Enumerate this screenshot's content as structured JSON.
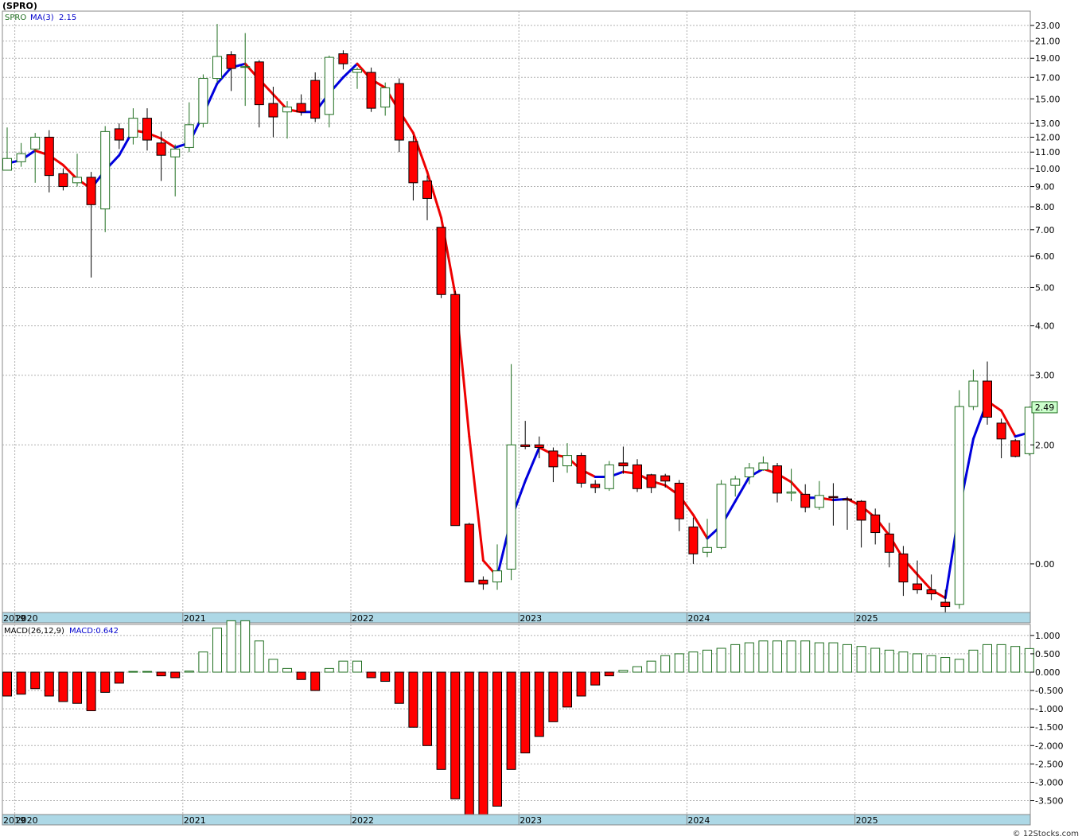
{
  "title": "(SPRO)",
  "legend": {
    "symbol": "SPRO",
    "ma_label": "MA(3)",
    "ma_value": "2.15"
  },
  "macd_label": {
    "name": "MACD(26,12,9)",
    "value_text": "MACD:0.642"
  },
  "last_price": "2.49",
  "watermark": "© 12Stocks.com",
  "colors": {
    "up": "#1f6e1f",
    "down": "#ff0000",
    "ma_up": "#0000dd",
    "ma_down": "#ee0000",
    "axis_band": "#add8e6"
  },
  "chart_data": [
    {
      "type": "candlestick",
      "name": "SPRO",
      "yscale": "log",
      "ylim": [
        0.75,
        25
      ],
      "x_labels": [
        "2019",
        "2020",
        "2021",
        "2022",
        "2023",
        "2024",
        "2025"
      ],
      "y_ticks": [
        23,
        21,
        19,
        17,
        15,
        13,
        12,
        11,
        10,
        9,
        8,
        7,
        6,
        5,
        4,
        3,
        2,
        1
      ],
      "y_tick_labels": [
        "23.00",
        "21.00",
        "19.00",
        "17.00",
        "15.00",
        "13.00",
        "12.00",
        "11.00",
        "10.00",
        "9.00",
        "8.00",
        "7.00",
        "6.00",
        "5.00",
        "4.00",
        "3.00",
        "2.00",
        "0.00"
      ],
      "candles": [
        {
          "date": "2019-12",
          "o": 9.9,
          "h": 12.7,
          "l": 9.9,
          "c": 10.6
        },
        {
          "date": "2020-01",
          "o": 10.4,
          "h": 11.6,
          "l": 10.1,
          "c": 10.9
        },
        {
          "date": "2020-02",
          "o": 11.2,
          "h": 12.3,
          "l": 9.2,
          "c": 12.0
        },
        {
          "date": "2020-03",
          "o": 12.0,
          "h": 12.5,
          "l": 8.7,
          "c": 9.6
        },
        {
          "date": "2020-04",
          "o": 9.7,
          "h": 10.0,
          "l": 8.8,
          "c": 9.0
        },
        {
          "date": "2020-05",
          "o": 9.2,
          "h": 10.9,
          "l": 9.0,
          "c": 9.5
        },
        {
          "date": "2020-06",
          "o": 9.5,
          "h": 9.8,
          "l": 5.3,
          "c": 8.1
        },
        {
          "date": "2020-07",
          "o": 7.9,
          "h": 12.8,
          "l": 6.9,
          "c": 12.4
        },
        {
          "date": "2020-08",
          "o": 12.6,
          "h": 13.0,
          "l": 11.2,
          "c": 11.8
        },
        {
          "date": "2020-09",
          "o": 12.0,
          "h": 14.2,
          "l": 11.5,
          "c": 13.4
        },
        {
          "date": "2020-10",
          "o": 13.4,
          "h": 14.2,
          "l": 11.1,
          "c": 11.8
        },
        {
          "date": "2020-11",
          "o": 11.6,
          "h": 12.4,
          "l": 9.3,
          "c": 10.8
        },
        {
          "date": "2020-12",
          "o": 10.7,
          "h": 11.5,
          "l": 8.5,
          "c": 11.2
        },
        {
          "date": "2021-01",
          "o": 11.3,
          "h": 14.7,
          "l": 11.0,
          "c": 12.9
        },
        {
          "date": "2021-02",
          "o": 13.0,
          "h": 17.3,
          "l": 12.7,
          "c": 16.9
        },
        {
          "date": "2021-03",
          "o": 16.9,
          "h": 23.2,
          "l": 16.5,
          "c": 19.2
        },
        {
          "date": "2021-04",
          "o": 19.4,
          "h": 19.8,
          "l": 15.7,
          "c": 17.9
        },
        {
          "date": "2021-05",
          "o": 18.1,
          "h": 22.0,
          "l": 14.4,
          "c": 18.1
        },
        {
          "date": "2021-06",
          "o": 18.6,
          "h": 18.8,
          "l": 12.7,
          "c": 14.5
        },
        {
          "date": "2021-07",
          "o": 14.6,
          "h": 16.1,
          "l": 12.0,
          "c": 13.5
        },
        {
          "date": "2021-08",
          "o": 13.9,
          "h": 14.8,
          "l": 11.9,
          "c": 14.3
        },
        {
          "date": "2021-09",
          "o": 14.6,
          "h": 15.4,
          "l": 13.6,
          "c": 13.9
        },
        {
          "date": "2021-10",
          "o": 16.7,
          "h": 17.5,
          "l": 13.1,
          "c": 13.4
        },
        {
          "date": "2021-11",
          "o": 13.7,
          "h": 19.3,
          "l": 12.7,
          "c": 19.1
        },
        {
          "date": "2021-12",
          "o": 19.5,
          "h": 19.9,
          "l": 17.8,
          "c": 18.4
        },
        {
          "date": "2022-01",
          "o": 17.5,
          "h": 18.0,
          "l": 15.9,
          "c": 17.8
        },
        {
          "date": "2022-02",
          "o": 17.5,
          "h": 18.0,
          "l": 13.9,
          "c": 14.2
        },
        {
          "date": "2022-03",
          "o": 14.3,
          "h": 16.5,
          "l": 13.6,
          "c": 16.0
        },
        {
          "date": "2022-04",
          "o": 16.4,
          "h": 16.9,
          "l": 11.0,
          "c": 11.8
        },
        {
          "date": "2022-05",
          "o": 11.7,
          "h": 12.1,
          "l": 8.3,
          "c": 9.2
        },
        {
          "date": "2022-06",
          "o": 9.3,
          "h": 9.6,
          "l": 7.4,
          "c": 8.4
        },
        {
          "date": "2022-07",
          "o": 7.1,
          "h": 7.1,
          "l": 4.7,
          "c": 4.8
        },
        {
          "date": "2022-08",
          "o": 4.8,
          "h": 4.9,
          "l": 1.25,
          "c": 1.25
        },
        {
          "date": "2022-09",
          "o": 1.26,
          "h": 1.27,
          "l": 0.9,
          "c": 0.9
        },
        {
          "date": "2022-10",
          "o": 0.91,
          "h": 0.93,
          "l": 0.86,
          "c": 0.89
        },
        {
          "date": "2022-11",
          "o": 0.9,
          "h": 1.12,
          "l": 0.86,
          "c": 0.96
        },
        {
          "date": "2022-12",
          "o": 0.97,
          "h": 3.2,
          "l": 0.91,
          "c": 2.0
        },
        {
          "date": "2023-01",
          "o": 2.0,
          "h": 2.3,
          "l": 1.95,
          "c": 1.98
        },
        {
          "date": "2023-02",
          "o": 2.0,
          "h": 2.1,
          "l": 1.85,
          "c": 1.97
        },
        {
          "date": "2023-03",
          "o": 1.93,
          "h": 1.97,
          "l": 1.61,
          "c": 1.76
        },
        {
          "date": "2023-04",
          "o": 1.77,
          "h": 2.02,
          "l": 1.7,
          "c": 1.88
        },
        {
          "date": "2023-05",
          "o": 1.88,
          "h": 1.91,
          "l": 1.56,
          "c": 1.6
        },
        {
          "date": "2023-06",
          "o": 1.59,
          "h": 1.63,
          "l": 1.51,
          "c": 1.56
        },
        {
          "date": "2023-07",
          "o": 1.55,
          "h": 1.82,
          "l": 1.53,
          "c": 1.78
        },
        {
          "date": "2023-08",
          "o": 1.8,
          "h": 1.98,
          "l": 1.69,
          "c": 1.77
        },
        {
          "date": "2023-09",
          "o": 1.78,
          "h": 1.84,
          "l": 1.52,
          "c": 1.55
        },
        {
          "date": "2023-10",
          "o": 1.68,
          "h": 1.69,
          "l": 1.51,
          "c": 1.56
        },
        {
          "date": "2023-11",
          "o": 1.67,
          "h": 1.69,
          "l": 1.56,
          "c": 1.62
        },
        {
          "date": "2023-12",
          "o": 1.6,
          "h": 1.63,
          "l": 1.21,
          "c": 1.3
        },
        {
          "date": "2024-01",
          "o": 1.24,
          "h": 1.31,
          "l": 1.0,
          "c": 1.06
        },
        {
          "date": "2024-02",
          "o": 1.07,
          "h": 1.3,
          "l": 1.04,
          "c": 1.1
        },
        {
          "date": "2024-03",
          "o": 1.1,
          "h": 1.63,
          "l": 1.09,
          "c": 1.59
        },
        {
          "date": "2024-04",
          "o": 1.58,
          "h": 1.67,
          "l": 1.48,
          "c": 1.64
        },
        {
          "date": "2024-05",
          "o": 1.66,
          "h": 1.8,
          "l": 1.59,
          "c": 1.75
        },
        {
          "date": "2024-06",
          "o": 1.73,
          "h": 1.87,
          "l": 1.72,
          "c": 1.8
        },
        {
          "date": "2024-07",
          "o": 1.77,
          "h": 1.8,
          "l": 1.43,
          "c": 1.51
        },
        {
          "date": "2024-08",
          "o": 1.51,
          "h": 1.74,
          "l": 1.44,
          "c": 1.52
        },
        {
          "date": "2024-09",
          "o": 1.5,
          "h": 1.59,
          "l": 1.35,
          "c": 1.39
        },
        {
          "date": "2024-10",
          "o": 1.39,
          "h": 1.62,
          "l": 1.37,
          "c": 1.49
        },
        {
          "date": "2024-11",
          "o": 1.48,
          "h": 1.6,
          "l": 1.25,
          "c": 1.47
        },
        {
          "date": "2024-12",
          "o": 1.46,
          "h": 1.48,
          "l": 1.22,
          "c": 1.45
        },
        {
          "date": "2025-01",
          "o": 1.44,
          "h": 1.45,
          "l": 1.1,
          "c": 1.29
        },
        {
          "date": "2025-02",
          "o": 1.33,
          "h": 1.38,
          "l": 1.12,
          "c": 1.2
        },
        {
          "date": "2025-03",
          "o": 1.19,
          "h": 1.27,
          "l": 0.98,
          "c": 1.07
        },
        {
          "date": "2025-04",
          "o": 1.06,
          "h": 1.11,
          "l": 0.83,
          "c": 0.9
        },
        {
          "date": "2025-05",
          "o": 0.89,
          "h": 1.02,
          "l": 0.84,
          "c": 0.86
        },
        {
          "date": "2025-06",
          "o": 0.86,
          "h": 0.94,
          "l": 0.81,
          "c": 0.84
        },
        {
          "date": "2025-07",
          "o": 0.8,
          "h": 0.86,
          "l": 0.75,
          "c": 0.78
        },
        {
          "date": "2025-08",
          "o": 0.79,
          "h": 2.75,
          "l": 0.77,
          "c": 2.5
        },
        {
          "date": "2025-09",
          "o": 2.5,
          "h": 3.1,
          "l": 2.45,
          "c": 2.9
        },
        {
          "date": "2025-10",
          "o": 2.9,
          "h": 3.25,
          "l": 2.25,
          "c": 2.35
        },
        {
          "date": "2025-11",
          "o": 2.27,
          "h": 2.33,
          "l": 1.85,
          "c": 2.07
        },
        {
          "date": "2025-12",
          "o": 2.05,
          "h": 2.07,
          "l": 1.86,
          "c": 1.87
        },
        {
          "date": "2026-01",
          "o": 1.9,
          "h": 2.5,
          "l": 1.88,
          "c": 2.49
        }
      ]
    },
    {
      "type": "line",
      "name": "MA(3)",
      "values": [
        10.3,
        10.5,
        11.1,
        10.8,
        10.2,
        9.4,
        8.9,
        9.9,
        10.8,
        12.5,
        12.3,
        11.9,
        11.3,
        11.6,
        13.7,
        16.4,
        18.0,
        18.4,
        16.8,
        15.4,
        14.1,
        13.9,
        13.9,
        15.5,
        17.0,
        18.4,
        16.8,
        16.0,
        14.0,
        12.3,
        9.8,
        7.5,
        4.8,
        2.1,
        1.02,
        0.93,
        1.3,
        1.62,
        1.97,
        1.89,
        1.86,
        1.73,
        1.66,
        1.66,
        1.71,
        1.69,
        1.62,
        1.58,
        1.49,
        1.33,
        1.16,
        1.25,
        1.44,
        1.66,
        1.74,
        1.69,
        1.61,
        1.47,
        1.47,
        1.45,
        1.46,
        1.4,
        1.31,
        1.18,
        1.03,
        0.94,
        0.86,
        0.82,
        1.37,
        2.07,
        2.58,
        2.44,
        2.1,
        2.15
      ]
    },
    {
      "type": "bar",
      "name": "MACD(26,12,9)",
      "ylim": [
        -3.9,
        1.3
      ],
      "y_ticks": [
        1.0,
        0.5,
        0.0,
        -0.5,
        -1.0,
        -1.5,
        -2.0,
        -2.5,
        -3.0,
        -3.5
      ],
      "y_tick_labels": [
        "1.000",
        "0.500",
        "0.000",
        "-0.500",
        "-1.000",
        "-1.500",
        "-2.000",
        "-2.500",
        "-3.000",
        "-3.500"
      ],
      "values": [
        -0.65,
        -0.6,
        -0.45,
        -0.65,
        -0.8,
        -0.85,
        -1.05,
        -0.55,
        -0.3,
        0.02,
        0.02,
        -0.1,
        -0.15,
        0.03,
        0.55,
        1.2,
        1.4,
        1.4,
        0.85,
        0.35,
        0.1,
        -0.2,
        -0.5,
        0.1,
        0.3,
        0.3,
        -0.15,
        -0.25,
        -0.85,
        -1.5,
        -2.0,
        -2.65,
        -3.45,
        -3.95,
        -3.95,
        -3.65,
        -2.65,
        -2.2,
        -1.75,
        -1.35,
        -0.95,
        -0.65,
        -0.35,
        -0.1,
        0.05,
        0.15,
        0.3,
        0.45,
        0.5,
        0.55,
        0.6,
        0.65,
        0.75,
        0.8,
        0.85,
        0.85,
        0.85,
        0.85,
        0.8,
        0.8,
        0.75,
        0.7,
        0.65,
        0.6,
        0.55,
        0.5,
        0.45,
        0.4,
        0.35,
        0.6,
        0.75,
        0.75,
        0.7,
        0.642
      ]
    }
  ]
}
